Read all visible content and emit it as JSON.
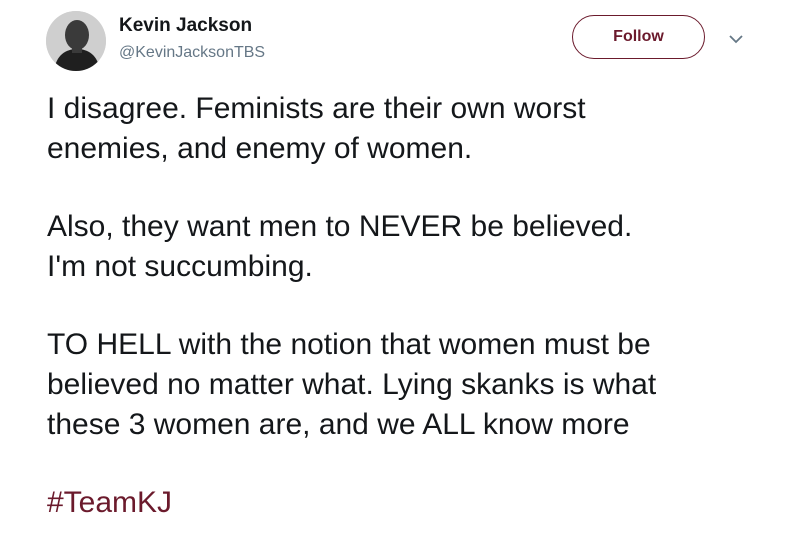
{
  "tweet": {
    "author": {
      "name": "Kevin Jackson",
      "handle": "@KevinJacksonTBS",
      "avatar_icon": "user-avatar-photo"
    },
    "follow_label": "Follow",
    "menu_icon": "chevron-down-icon",
    "accent_color": "#6b1a2c",
    "paragraphs": [
      [
        "I disagree. Feminists are their own worst",
        "enemies, and enemy of women."
      ],
      [
        "Also, they want men to NEVER be believed.",
        "I'm not succumbing."
      ],
      [
        "TO HELL with the notion that women must be",
        "believed no matter what. Lying skanks is what",
        "these 3 women are, and we ALL know more"
      ]
    ],
    "hashtag": "#TeamKJ"
  }
}
